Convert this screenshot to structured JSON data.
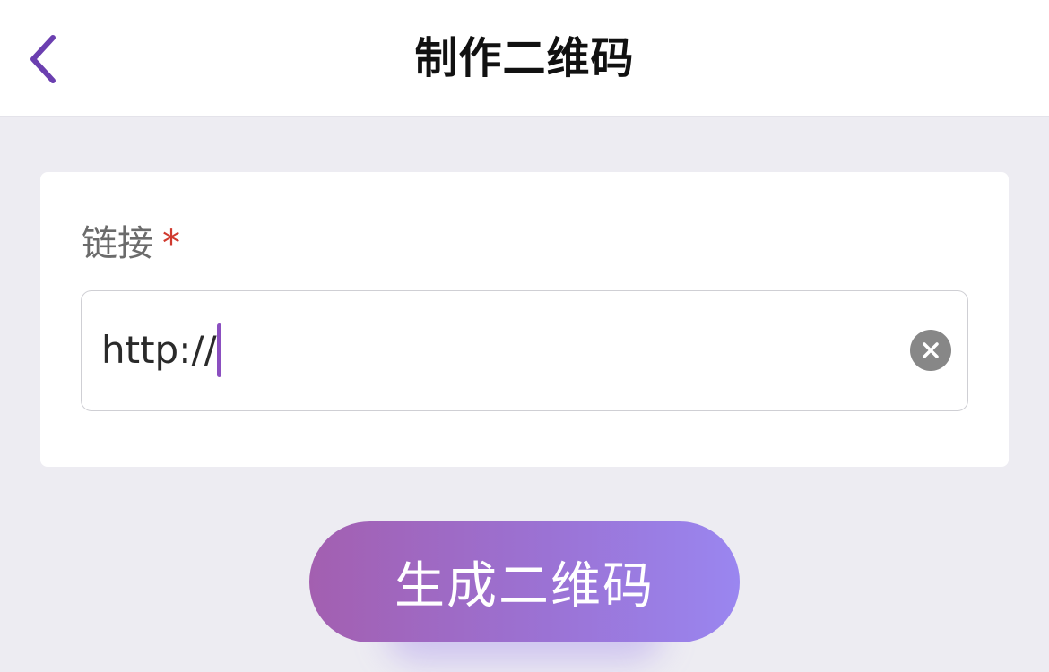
{
  "header": {
    "title": "制作二维码",
    "back_icon": "chevron-left-icon",
    "accent_color": "#6b3fb0"
  },
  "form": {
    "link_label": "链接",
    "required_mark": "*",
    "link_value": "http://",
    "clear_icon": "close-circle-icon"
  },
  "actions": {
    "generate_label": "生成二维码",
    "gradient_start": "#a35fb0",
    "gradient_end": "#9a86f0"
  }
}
